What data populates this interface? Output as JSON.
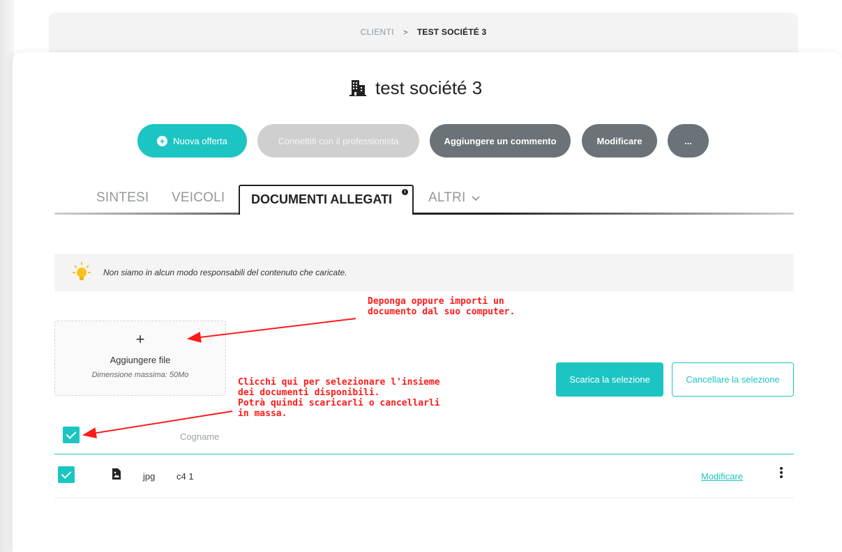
{
  "breadcrumb": {
    "root": "CLIENTI",
    "separator": ">",
    "current": "TEST SOCIÉTÉ 3"
  },
  "page": {
    "title": "test société 3",
    "icon": "building-icon"
  },
  "actions": {
    "new_offer": "Nuova offerta",
    "connect_pro": "Connettiti con il professionista",
    "add_comment": "Aggiungere un commento",
    "edit": "Modificare",
    "more": "..."
  },
  "tabs": {
    "synthesis": "SINTESI",
    "vehicles": "VEICOLI",
    "documents": "DOCUMENTI ALLEGATI",
    "others": "ALTRI"
  },
  "notice": {
    "icon": "lightbulb-icon",
    "text": "Non siamo in alcun modo responsabili del contenuto che caricate."
  },
  "dropzone": {
    "plus": "+",
    "label": "Aggiungere file",
    "max_size": "Dimensione massima: 50Mo"
  },
  "bulk": {
    "download": "Scarica la selezione",
    "delete": "Cancellare la selezione"
  },
  "table": {
    "column_name": "Cogname",
    "rows": [
      {
        "type": "jpg",
        "name": "c4 1",
        "action": "Modificare",
        "selected": true
      }
    ]
  },
  "callouts": {
    "upload": "Deponga oppure importi un\ndocumento dal suo computer.",
    "select_all": "Clicchi qui per selezionare l'insieme\ndei documenti disponibili.\nPotrà quindi scaricarli o cancellarli\nin massa."
  },
  "colors": {
    "accent": "#1cc5c2",
    "grey_button": "#6b7379",
    "disabled": "#cfcfcf",
    "callout": "#ff1a1a"
  }
}
